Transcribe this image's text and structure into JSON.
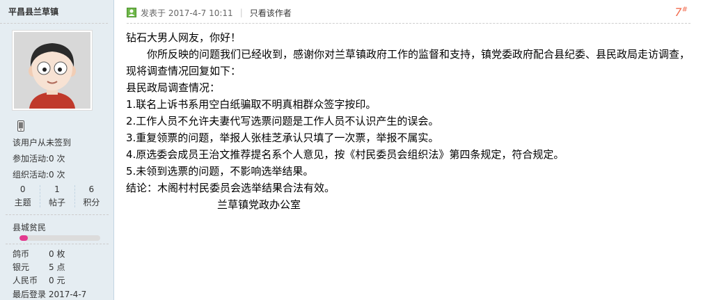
{
  "user": {
    "name": "平昌县兰草镇",
    "checkin_status": "该用户从未签到",
    "activity_join": "参加活动:0 次",
    "activity_org": "组织活动:0 次",
    "stats": [
      {
        "value": "0",
        "label": "主题"
      },
      {
        "value": "1",
        "label": "帖子"
      },
      {
        "value": "6",
        "label": "积分"
      }
    ],
    "level": "县城贫民",
    "level_progress": 0.1,
    "assets": [
      {
        "key": "鸽币",
        "value": "0 枚"
      },
      {
        "key": "银元",
        "value": "5 点"
      },
      {
        "key": "人民币",
        "value": "0 元"
      }
    ],
    "last_login": "最后登录 2017-4-7"
  },
  "post": {
    "posted_at": "发表于 2017-4-7 10:11",
    "only_author": "只看该作者",
    "floor": "7",
    "floor_mark": "#",
    "lines": [
      "钻石大男人网友，你好！",
      "你所反映的问题我们已经收到，感谢你对兰草镇政府工作的监督和支持，镇党委政府配合县纪委、县民政局走访调查，现将调查情况回复如下：",
      "县民政局调查情况：",
      "1.联名上诉书系用空白纸骗取不明真相群众签字按印。",
      "2.工作人员不允许夫妻代写选票问题是工作人员不认识产生的误会。",
      "3.重复领票的问题，举报人张桂芝承认只填了一次票，举报不属实。",
      "4.原选委会成员王治文推荐提名系个人意见，按《村民委员会组织法》第四条规定，符合规定。",
      "5.未领到选票的问题，不影响选举结果。",
      "结论：木阁村村民委员会选举结果合法有效。",
      "兰草镇党政办公室"
    ]
  },
  "colors": {
    "sidebar_bg": "#e5edf2",
    "floor": "#f26c4f",
    "level_fill": "#e33a8f"
  }
}
